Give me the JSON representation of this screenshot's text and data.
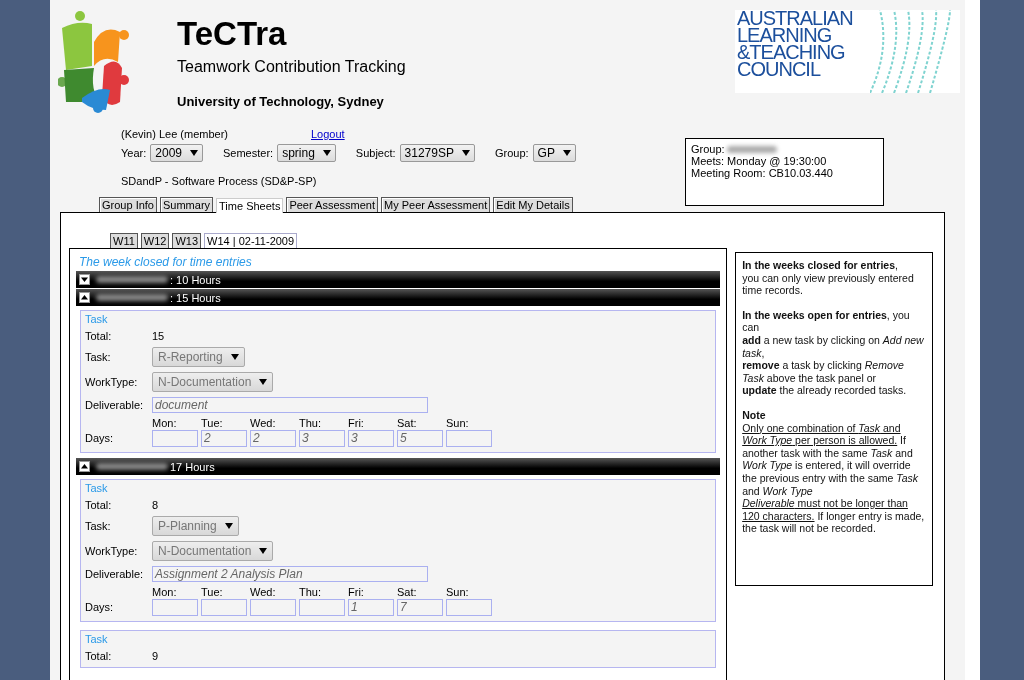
{
  "header": {
    "title": "TeCTra",
    "subtitle": "Teamwork Contribution Tracking",
    "university": "University of Technology, Sydney",
    "partner_logo": [
      "AUSTRALIAN",
      "LEARNING",
      "&TEACHING",
      "COUNCIL"
    ]
  },
  "user": {
    "name": "(Kevin) Lee (member)",
    "logout": "Logout"
  },
  "filters": [
    {
      "label": "Year:",
      "value": "2009"
    },
    {
      "label": "Semester:",
      "value": "spring"
    },
    {
      "label": "Subject:",
      "value": "31279SP"
    },
    {
      "label": "Group:",
      "value": "GP"
    }
  ],
  "subject_name": "SDandP - Software Process (SD&P-SP)",
  "group_info": {
    "group_label": "Group:",
    "meets": "Meets: Monday @ 19:30:00",
    "room": "Meeting Room: CB10.03.440"
  },
  "tabs": [
    {
      "label": "Group Info",
      "selected": false
    },
    {
      "label": "Summary",
      "selected": false
    },
    {
      "label": "Time Sheets",
      "selected": true
    },
    {
      "label": "Peer Assessment",
      "selected": false
    },
    {
      "label": "My Peer Assessment",
      "selected": false
    },
    {
      "label": "Edit My Details",
      "selected": false
    }
  ],
  "week_tabs": [
    {
      "label": "W11",
      "selected": false
    },
    {
      "label": "W12",
      "selected": false
    },
    {
      "label": "W13",
      "selected": false
    },
    {
      "label": "W14 | 02-11-2009",
      "selected": true
    }
  ],
  "status_message": "The week closed for time entries",
  "members": [
    {
      "hours": ": 10 Hours",
      "expanded": false
    },
    {
      "hours": ": 15 Hours",
      "expanded": true,
      "tasks": [
        {
          "heading": "Task",
          "total_label": "Total:",
          "total": "15",
          "task_label": "Task:",
          "task": "R-Reporting",
          "worktype_label": "WorkType:",
          "worktype": "N-Documentation",
          "deliverable_label": "Deliverable:",
          "deliverable": "document",
          "days_label": "Days:",
          "days": [
            {
              "label": "Mon:"
            },
            {
              "label": "Tue:",
              "value": "2"
            },
            {
              "label": "Wed:",
              "value": "2"
            },
            {
              "label": "Thu:",
              "value": "3"
            },
            {
              "label": "Fri:",
              "value": "3"
            },
            {
              "label": "Sat:",
              "value": "5"
            },
            {
              "label": "Sun:"
            }
          ]
        }
      ]
    },
    {
      "hours": "17 Hours",
      "expanded": true,
      "tasks": [
        {
          "heading": "Task",
          "total_label": "Total:",
          "total": "8",
          "task_label": "Task:",
          "task": "P-Planning",
          "worktype_label": "WorkType:",
          "worktype": "N-Documentation",
          "deliverable_label": "Deliverable:",
          "deliverable": "Assignment 2 Analysis Plan",
          "days_label": "Days:",
          "days": [
            {
              "label": "Mon:"
            },
            {
              "label": "Tue:"
            },
            {
              "label": "Wed:"
            },
            {
              "label": "Thu:"
            },
            {
              "label": "Fri:",
              "value": "1"
            },
            {
              "label": "Sat:",
              "value": "7"
            },
            {
              "label": "Sun:"
            }
          ]
        },
        {
          "heading": "Task",
          "total_label": "Total:",
          "total": "9"
        }
      ]
    }
  ],
  "help": {
    "paragraphs": [
      [
        "**In the weeks closed for entries**,",
        "you can only view previously entered time records."
      ],
      [
        "**In the weeks open for entries**, you can",
        "**add** a new task by clicking on *Add new task*,",
        "**remove** a task by clicking *Remove Task* above the task panel or",
        "**update** the already recorded tasks."
      ]
    ],
    "note_heading": "Note",
    "note": [
      {
        "text": "Only one combination of *Task* and *Work Type* per person is allowed.",
        "underlined": true,
        "break_before": false
      },
      {
        "text": " If another task with the same *Task* and *Work Type* is entered, it will override the previous entry with the same *Task* and *Work Type*",
        "underlined": false,
        "break_before": false
      },
      {
        "text": "*Deliverable* must not be longer than 120 characters.",
        "underlined": true,
        "break_before": true
      },
      {
        "text": " If longer entry is made, the task will not be recorded.",
        "underlined": false,
        "break_before": false
      }
    ]
  }
}
